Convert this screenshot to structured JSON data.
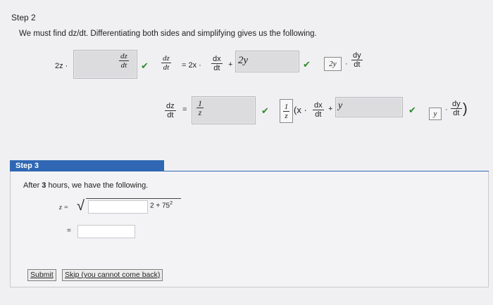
{
  "step2": {
    "title": "Step 2",
    "intro": "We must find dz/dt. Differentiating both sides and simplifying gives us the following.",
    "row1": {
      "lhs_prefix": "2z ·",
      "box1": {
        "num": "dz",
        "den": "dt"
      },
      "frac2": {
        "num": "dz",
        "den": "dt"
      },
      "eq_text": "= 2x ·",
      "frac3": {
        "num": "dx",
        "den": "dt"
      },
      "plus": "+",
      "box2_value": "2y",
      "small_box_value": "2y",
      "dot": "·",
      "frac4": {
        "num": "dy",
        "den": "dt"
      }
    },
    "row2": {
      "frac_lhs": {
        "num": "dz",
        "den": "dt"
      },
      "eq": "=",
      "box3": {
        "num": "1",
        "den": "z"
      },
      "small_frac": {
        "num": "1",
        "den": "z"
      },
      "paren_open": "(x ·",
      "frac_dx": {
        "num": "dx",
        "den": "dt"
      },
      "plus": "+",
      "box4_value": "y",
      "small_box_value": "y",
      "dot": "·",
      "frac_dy": {
        "num": "dy",
        "den": "dt"
      },
      "paren_close": ")"
    },
    "checkmark": "✔"
  },
  "step3": {
    "title": "Step 3",
    "intro_prefix": "After ",
    "intro_hours": "3",
    "intro_suffix": " hours, we have the following.",
    "z_label": "z =",
    "sqrt_symbol": "√",
    "sqrt_tail": "2 + 75",
    "sqrt_tail_exp": "2",
    "eq2": "=",
    "submit_label": "Submit",
    "skip_label": "Skip (you cannot come back)"
  },
  "colors": {
    "accent": "#2f67b4",
    "check": "#2f8a2f"
  }
}
